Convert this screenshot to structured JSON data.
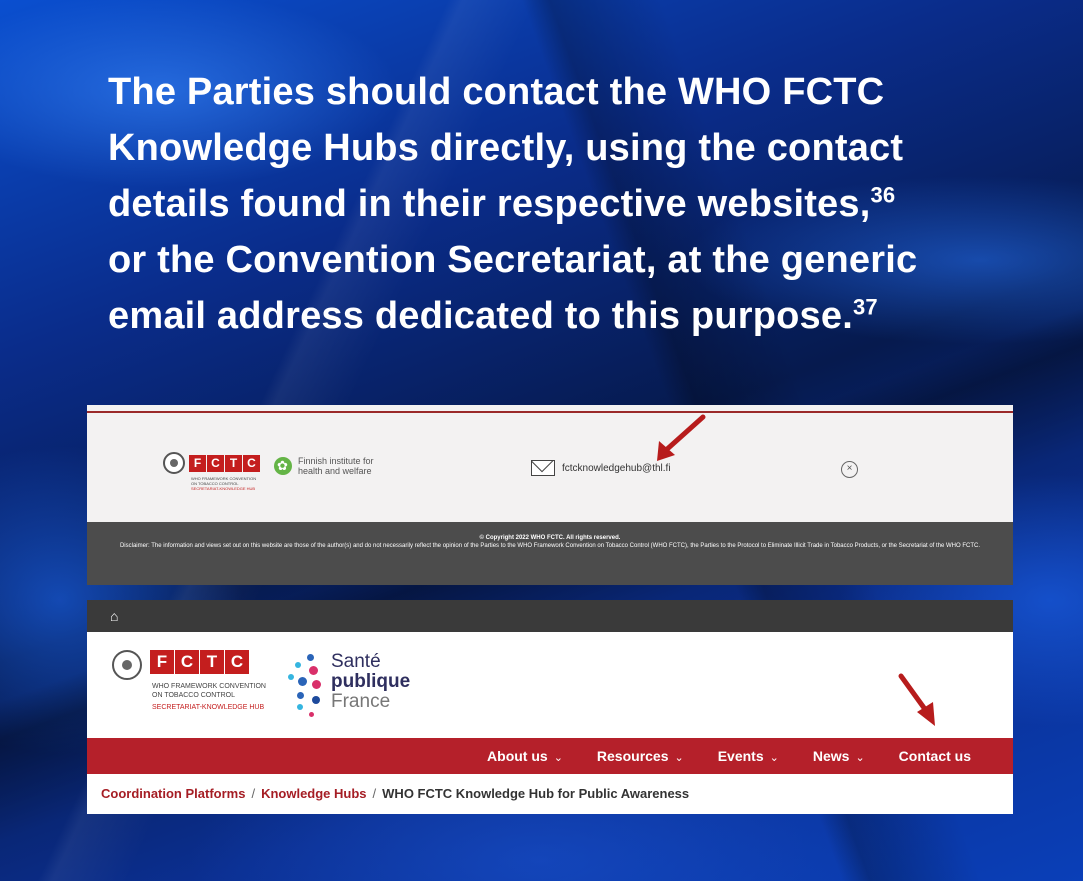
{
  "headline": {
    "line1": "The Parties should contact the WHO FCTC",
    "line2": "Knowledge Hubs directly, using the contact",
    "line3": "details found in their respective websites,",
    "ref1": "36",
    "line4": "or the Convention Secretariat, at the generic",
    "line5": "email address dedicated to this purpose.",
    "ref2": "37"
  },
  "screenshot_finland": {
    "fctc_letters": [
      "F",
      "C",
      "T",
      "C"
    ],
    "fctc_sub_line1": "WHO FRAMEWORK CONVENTION",
    "fctc_sub_line2": "ON TOBACCO CONTROL",
    "fctc_sub_line3": "SECRETARIAT-KNOWLEDGE HUB",
    "partner_line1": "Finnish institute for",
    "partner_line2": "health and welfare",
    "email": "fctcknowledgehub@thl.fi",
    "close_glyph": "×",
    "footer_copyright": "© Copyright 2022 WHO FCTC. All rights reserved.",
    "footer_disclaimer": "Disclaimer: The information and views set out on this website are those of the author(s) and do not necessarily reflect the opinion of the Parties to the WHO Framework Convention on Tobacco Control (WHO FCTC), the Parties to the Protocol to Eliminate Illicit Trade in Tobacco Products, or the Secretariat of the WHO FCTC."
  },
  "screenshot_france": {
    "home_glyph": "⌂",
    "fctc_letters": [
      "F",
      "C",
      "T",
      "C"
    ],
    "fctc_sub_line1": "WHO FRAMEWORK CONVENTION",
    "fctc_sub_line2": "ON TOBACCO CONTROL",
    "fctc_sub_line3": "SECRETARIAT-KNOWLEDGE HUB",
    "partner_line1": "Santé",
    "partner_line2": "publique",
    "partner_line3": "France",
    "nav": [
      {
        "label": "About us",
        "caret": "⌄"
      },
      {
        "label": "Resources",
        "caret": "⌄"
      },
      {
        "label": "Events",
        "caret": "⌄"
      },
      {
        "label": "News",
        "caret": "⌄"
      },
      {
        "label": "Contact us",
        "caret": ""
      }
    ],
    "breadcrumb": {
      "crumb1": "Coordination Platforms",
      "crumb2": "Knowledge Hubs",
      "current": "WHO FCTC Knowledge Hub for Public Awareness",
      "separator": "/"
    }
  },
  "colors": {
    "fctc_red": "#c41e1e",
    "nav_red": "#b5202a",
    "arrow_red": "#b71c1c",
    "footer_gray": "#4c4c4c"
  }
}
